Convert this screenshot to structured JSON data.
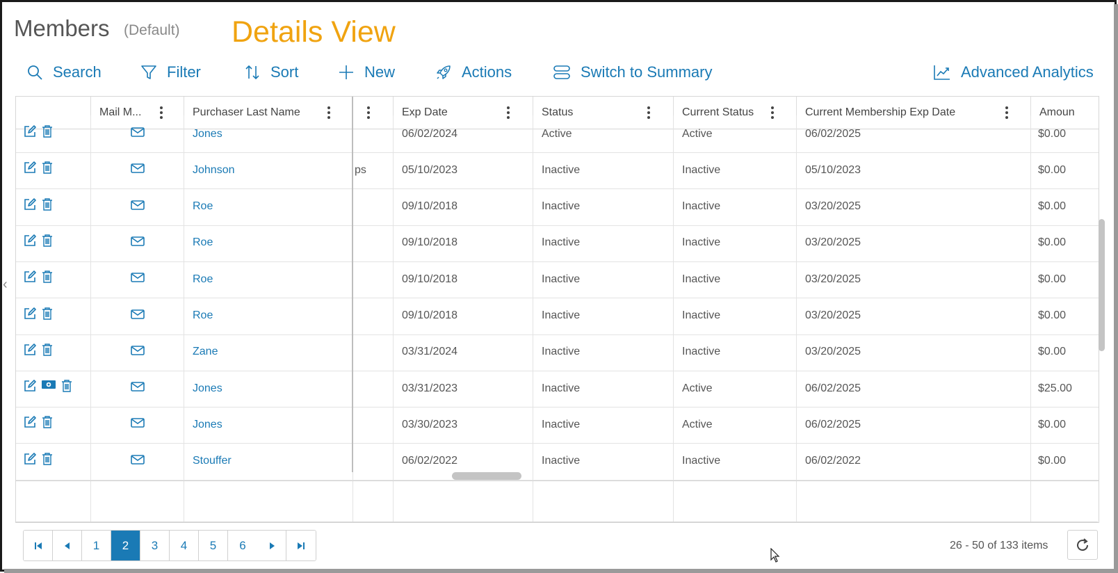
{
  "header": {
    "title": "Members",
    "view_name": "(Default)",
    "annotation": "Details View"
  },
  "toolbar": {
    "search": "Search",
    "filter": "Filter",
    "sort": "Sort",
    "new": "New",
    "actions": "Actions",
    "switch": "Switch to Summary",
    "analytics": "Advanced Analytics"
  },
  "columns": [
    "",
    "Mail M...",
    "Purchaser Last Name",
    "",
    "Exp Date",
    "Status",
    "Current Status",
    "Current Membership Exp Date",
    "Amoun"
  ],
  "rows": [
    {
      "last_name": "Jones",
      "partial": "",
      "exp_date": "06/02/2024",
      "status": "Active",
      "current_status": "Active",
      "current_exp": "06/02/2025",
      "amount": "$0.00",
      "has_money": false
    },
    {
      "last_name": "Johnson",
      "partial": "ps",
      "exp_date": "05/10/2023",
      "status": "Inactive",
      "current_status": "Inactive",
      "current_exp": "05/10/2023",
      "amount": "$0.00",
      "has_money": false
    },
    {
      "last_name": "Roe",
      "partial": "",
      "exp_date": "09/10/2018",
      "status": "Inactive",
      "current_status": "Inactive",
      "current_exp": "03/20/2025",
      "amount": "$0.00",
      "has_money": false
    },
    {
      "last_name": "Roe",
      "partial": "",
      "exp_date": "09/10/2018",
      "status": "Inactive",
      "current_status": "Inactive",
      "current_exp": "03/20/2025",
      "amount": "$0.00",
      "has_money": false
    },
    {
      "last_name": "Roe",
      "partial": "",
      "exp_date": "09/10/2018",
      "status": "Inactive",
      "current_status": "Inactive",
      "current_exp": "03/20/2025",
      "amount": "$0.00",
      "has_money": false
    },
    {
      "last_name": "Roe",
      "partial": "",
      "exp_date": "09/10/2018",
      "status": "Inactive",
      "current_status": "Inactive",
      "current_exp": "03/20/2025",
      "amount": "$0.00",
      "has_money": false
    },
    {
      "last_name": "Zane",
      "partial": "",
      "exp_date": "03/31/2024",
      "status": "Inactive",
      "current_status": "Inactive",
      "current_exp": "03/20/2025",
      "amount": "$0.00",
      "has_money": false
    },
    {
      "last_name": "Jones",
      "partial": "",
      "exp_date": "03/31/2023",
      "status": "Inactive",
      "current_status": "Active",
      "current_exp": "06/02/2025",
      "amount": "$25.00",
      "has_money": true
    },
    {
      "last_name": "Jones",
      "partial": "",
      "exp_date": "03/30/2023",
      "status": "Inactive",
      "current_status": "Active",
      "current_exp": "06/02/2025",
      "amount": "$0.00",
      "has_money": false
    },
    {
      "last_name": "Stouffer",
      "partial": "",
      "exp_date": "06/02/2022",
      "status": "Inactive",
      "current_status": "Inactive",
      "current_exp": "06/02/2022",
      "amount": "$0.00",
      "has_money": false
    }
  ],
  "pager": {
    "pages": [
      "1",
      "2",
      "3",
      "4",
      "5",
      "6"
    ],
    "current": "2",
    "info": "26 - 50 of 133 items"
  },
  "colors": {
    "accent": "#1a7ab5",
    "annotation": "#f0a310"
  }
}
